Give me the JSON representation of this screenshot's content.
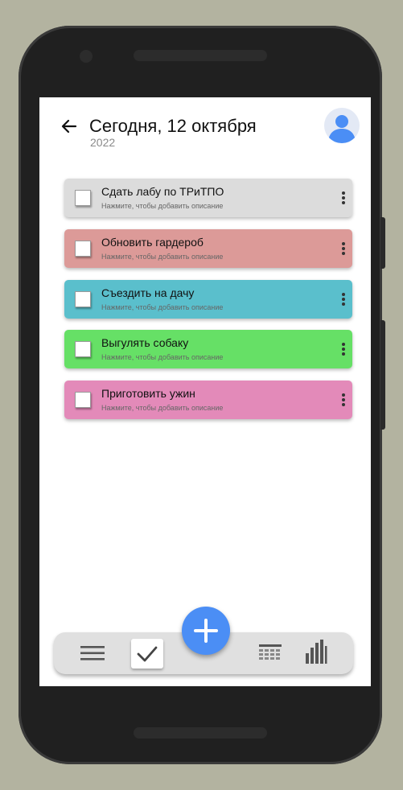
{
  "header": {
    "title": "Сегодня, 12 октября",
    "year": "2022",
    "back_icon": "arrow-left-icon",
    "avatar_icon": "user-avatar-icon"
  },
  "tasks": [
    {
      "title": "Сдать лабу по ТРиТПО",
      "description": "Нажмите, чтобы добавить описание",
      "color": "#dcdcdc",
      "checked": false
    },
    {
      "title": "Обновить гардероб",
      "description": "Нажмите, чтобы добавить описание",
      "color": "#dc9a98",
      "checked": false
    },
    {
      "title": "Съездить на дачу",
      "description": "Нажмите, чтобы добавить описание",
      "color": "#5abfcc",
      "checked": false
    },
    {
      "title": "Выгулять собаку",
      "description": "Нажмите, чтобы добавить описание",
      "color": "#66e066",
      "checked": false
    },
    {
      "title": "Приготовить ужин",
      "description": "Нажмите, чтобы добавить описание",
      "color": "#e38ab9",
      "checked": false
    }
  ],
  "bottom_nav": {
    "items": [
      "menu-icon",
      "check-icon",
      "calendar-icon",
      "stats-icon"
    ],
    "active": "check-icon",
    "fab_icon": "plus-icon"
  },
  "colors": {
    "accent": "#4b8ef5",
    "avatar": "#4b8ef5"
  }
}
